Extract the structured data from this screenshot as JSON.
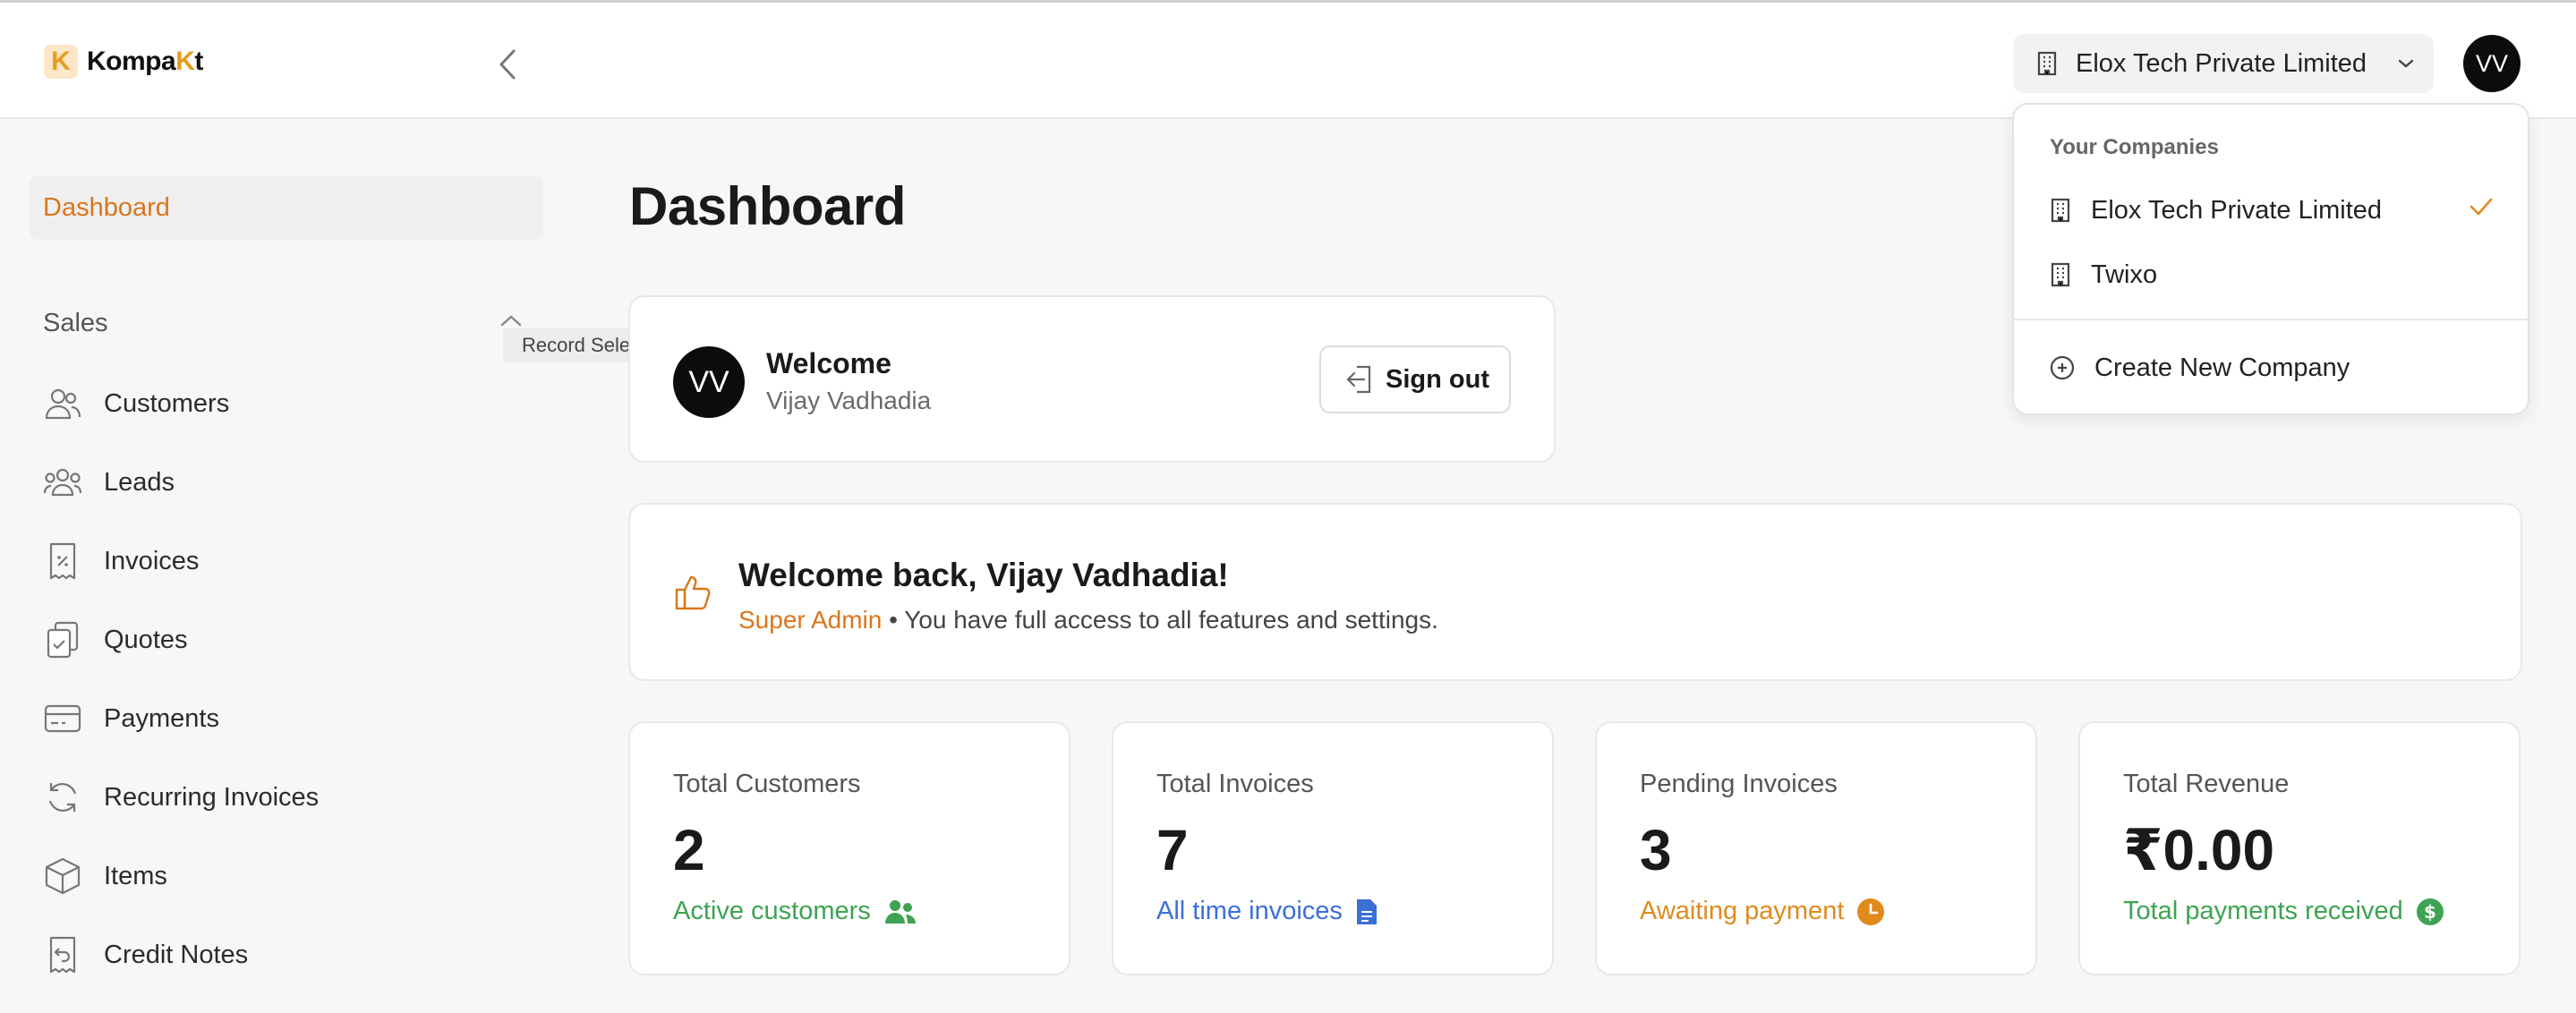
{
  "brand": {
    "logo_letter": "K",
    "name_prefix": "Kompa",
    "name_accent": "K",
    "name_suffix": "t"
  },
  "header": {
    "company_name": "Elox Tech Private Limited",
    "avatar_initials": "VV"
  },
  "sidebar": {
    "active_item": "Dashboard",
    "section_title": "Sales",
    "items": [
      {
        "label": "Customers",
        "icon": "users-icon"
      },
      {
        "label": "Leads",
        "icon": "group-icon"
      },
      {
        "label": "Invoices",
        "icon": "receipt-icon"
      },
      {
        "label": "Quotes",
        "icon": "clipboard-icon"
      },
      {
        "label": "Payments",
        "icon": "credit-card-icon"
      },
      {
        "label": "Recurring Invoices",
        "icon": "refresh-icon"
      },
      {
        "label": "Items",
        "icon": "box-icon"
      },
      {
        "label": "Credit Notes",
        "icon": "receipt-return-icon"
      }
    ]
  },
  "tooltip": "Record Selected Window",
  "main": {
    "title": "Dashboard",
    "welcome": {
      "avatar_initials": "VV",
      "title": "Welcome",
      "user": "Vijay Vadhadia",
      "signout_label": "Sign out"
    },
    "banner": {
      "title": "Welcome back, Vijay Vadhadia!",
      "role": "Super Admin",
      "separator": "•",
      "message": "You have full access to all features and settings."
    },
    "stats": [
      {
        "label": "Total Customers",
        "value": "2",
        "note": "Active customers",
        "color": "#3ea352",
        "icon": "users-icon"
      },
      {
        "label": "Total Invoices",
        "value": "7",
        "note": "All time invoices",
        "color": "#3b6fd8",
        "icon": "document-icon"
      },
      {
        "label": "Pending Invoices",
        "value": "3",
        "note": "Awaiting payment",
        "color": "#e08a1e",
        "icon": "clock-icon"
      },
      {
        "label": "Total Revenue",
        "value": "₹0.00",
        "note": "Total payments received",
        "color": "#3ea352",
        "icon": "dollar-icon"
      }
    ]
  },
  "dropdown": {
    "header": "Your Companies",
    "companies": [
      {
        "name": "Elox Tech Private Limited",
        "selected": true
      },
      {
        "name": "Twixo",
        "selected": false
      }
    ],
    "create_label": "Create New Company"
  },
  "colors": {
    "accent": "#d9761c",
    "brand": "#e79b1f"
  }
}
